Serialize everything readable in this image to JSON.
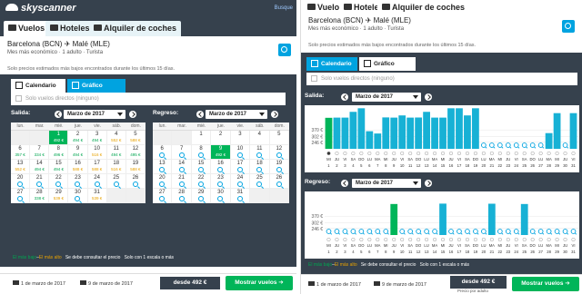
{
  "left": {
    "brand": "skyscanner",
    "top_link": "Busque",
    "tabs": [
      {
        "label": "Vuelos",
        "active": true
      },
      {
        "label": "Hoteles",
        "active": false
      },
      {
        "label": "Alquiler de coches",
        "active": false
      }
    ],
    "route": "Barcelona (BCN)  ✈  Malé (MLE)",
    "route_meta": "Mes más económico  ·  1 adulto  ·  Turista",
    "note": "Solo precios estimados más bajos encontrados durante los últimos 15 días.",
    "view_tabs": {
      "calendar": "Calendario",
      "chart": "Gráfico"
    },
    "direct_only": "Solo vuelos directos (ninguno)",
    "outbound_label": "Salida:",
    "return_label": "Regreso:",
    "month": "Marzo de 2017",
    "weekdays": [
      "lun.",
      "mar.",
      "mié.",
      "jue.",
      "vie.",
      "sáb.",
      "dom."
    ],
    "outbound_days": [
      {
        "d": ""
      },
      {
        "d": ""
      },
      {
        "d": "1",
        "p": "492 €",
        "sel": true
      },
      {
        "d": "2",
        "p": "494 €"
      },
      {
        "d": "3",
        "p": "494 €"
      },
      {
        "d": "4",
        "p": "552 €"
      },
      {
        "d": "5",
        "p": "588 €"
      },
      {
        "d": "6",
        "p": "357 €"
      },
      {
        "d": "7",
        "p": "334 €"
      },
      {
        "d": "8",
        "p": "496 €"
      },
      {
        "d": "9",
        "p": "494 €"
      },
      {
        "d": "10",
        "p": "516 €"
      },
      {
        "d": "11",
        "p": "494 €"
      },
      {
        "d": "12",
        "p": "495 €"
      },
      {
        "d": "13",
        "p": "552 €"
      },
      {
        "d": "14",
        "p": "494 €"
      },
      {
        "d": "15",
        "p": "494 €"
      },
      {
        "d": "16",
        "p": "588 €"
      },
      {
        "d": "17",
        "p": "588 €"
      },
      {
        "d": "18",
        "p": "516 €"
      },
      {
        "d": "19",
        "p": "588 €"
      },
      {
        "d": "20",
        "s": true
      },
      {
        "d": "21",
        "s": true
      },
      {
        "d": "22",
        "s": true
      },
      {
        "d": "23",
        "s": true
      },
      {
        "d": "24",
        "s": true
      },
      {
        "d": "25",
        "s": true
      },
      {
        "d": "26",
        "s": true
      },
      {
        "d": "27",
        "s": true
      },
      {
        "d": "28",
        "p": "338 €"
      },
      {
        "d": "29",
        "p": "539 €"
      },
      {
        "d": "30",
        "s": true
      },
      {
        "d": "31",
        "p": "539 €"
      },
      {
        "d": ""
      },
      {
        "d": ""
      }
    ],
    "return_days": [
      {
        "d": ""
      },
      {
        "d": ""
      },
      {
        "d": "1"
      },
      {
        "d": "2"
      },
      {
        "d": "3"
      },
      {
        "d": "4"
      },
      {
        "d": "5"
      },
      {
        "d": "6",
        "s": true
      },
      {
        "d": "7",
        "s": true
      },
      {
        "d": "8",
        "s": true
      },
      {
        "d": "9",
        "p": "492 €",
        "sel": true
      },
      {
        "d": "10",
        "s": true
      },
      {
        "d": "11",
        "s": true
      },
      {
        "d": "12",
        "s": true
      },
      {
        "d": "13",
        "s": true
      },
      {
        "d": "14",
        "s": true
      },
      {
        "d": "15",
        "s": true
      },
      {
        "d": "16",
        "s": true
      },
      {
        "d": "17",
        "s": true
      },
      {
        "d": "18",
        "s": true
      },
      {
        "d": "19",
        "s": true
      },
      {
        "d": "20",
        "s": true
      },
      {
        "d": "21",
        "s": true
      },
      {
        "d": "22",
        "s": true
      },
      {
        "d": "23",
        "s": true
      },
      {
        "d": "24",
        "s": true
      },
      {
        "d": "25",
        "s": true
      },
      {
        "d": "26",
        "s": true
      },
      {
        "d": "27",
        "s": true
      },
      {
        "d": "28",
        "s": true
      },
      {
        "d": "29",
        "s": true
      },
      {
        "d": "30",
        "s": true
      },
      {
        "d": "31",
        "s": true
      },
      {
        "d": ""
      },
      {
        "d": ""
      }
    ],
    "legend_low": "El más bajo",
    "legend_high": "El más alto",
    "legend_consult": "Se debe consultar el precio",
    "legend_stops": "Solo con 1 escala o más",
    "depart_date": "1 de marzo de 2017",
    "return_date": "9 de marzo de 2017",
    "from_price": "desde 492 €",
    "show_flights": "Mostrar vuelos"
  },
  "right": {
    "tabs": [
      {
        "label": "Vuelos",
        "active": true
      },
      {
        "label": "Hoteles",
        "active": false
      },
      {
        "label": "Alquiler de coches",
        "active": false
      }
    ],
    "route": "Barcelona (BCN)  ✈  Malé (MLE)",
    "route_meta": "Mes más económico  ·  1 adulto  ·  Turista",
    "note": "Solo precios estimados más bajos encontrados durante los últimos 15 días.",
    "view_tabs": {
      "calendar": "Calendario",
      "chart": "Gráfico"
    },
    "direct_only": "Solo vuelos directos (ninguno)",
    "outbound_label": "Salida:",
    "return_label": "Regreso:",
    "month": "Marzo de 2017",
    "legend_low": "El más bajo",
    "legend_high": "El más alto",
    "legend_consult": "Se debe consultar el precio",
    "legend_stops": "Solo con 1 escala o más",
    "depart_date": "1 de marzo de 2017",
    "return_date": "9 de marzo de 2017",
    "from_price": "desde 492 €",
    "price_note": "Precio por adulto",
    "show_flights": "Mostrar vuelos"
  },
  "colors": {
    "dark": "#36414d",
    "accent": "#00a3e0",
    "green": "#00b559",
    "bar": "#17b1d5"
  },
  "chart_data": [
    {
      "type": "bar",
      "title": "Salida:",
      "categories": [
        "MI",
        "JU",
        "VI",
        "SA",
        "DO",
        "LU",
        "MA",
        "MI",
        "JU",
        "VI",
        "SA",
        "DO",
        "LU",
        "MA",
        "MI",
        "JU",
        "VI",
        "SA",
        "DO",
        "LU",
        "MA",
        "MI",
        "JU",
        "VI",
        "SA",
        "DO",
        "LU",
        "MA",
        "MI",
        "JU",
        "VI"
      ],
      "days": [
        "1",
        "2",
        "3",
        "4",
        "5",
        "6",
        "7",
        "8",
        "9",
        "10",
        "11",
        "12",
        "13",
        "14",
        "15",
        "16",
        "17",
        "18",
        "19",
        "20",
        "21",
        "22",
        "23",
        "24",
        "25",
        "26",
        "27",
        "28",
        "29",
        "30",
        "31"
      ],
      "values": [
        492,
        494,
        494,
        552,
        588,
        357,
        334,
        496,
        494,
        516,
        494,
        495,
        552,
        494,
        494,
        588,
        588,
        516,
        588,
        null,
        null,
        null,
        null,
        null,
        null,
        null,
        null,
        338,
        539,
        null,
        539
      ],
      "yticks": [
        "370 €",
        "302 €",
        "246 €"
      ],
      "ylim": [
        180,
        600
      ]
    },
    {
      "type": "bar",
      "title": "Regreso:",
      "categories": [
        "MI",
        "JU",
        "VI",
        "SA",
        "DO",
        "LU",
        "MA",
        "MI",
        "JU",
        "VI",
        "SA",
        "DO",
        "LU",
        "MA",
        "MI",
        "JU",
        "VI",
        "SA",
        "DO",
        "LU",
        "MA",
        "MI",
        "JU",
        "VI",
        "SA",
        "DO",
        "LU",
        "MA",
        "MI",
        "JU",
        "VI"
      ],
      "days": [
        "1",
        "2",
        "3",
        "4",
        "5",
        "6",
        "7",
        "8",
        "9",
        "10",
        "11",
        "12",
        "13",
        "14",
        "15",
        "16",
        "17",
        "18",
        "19",
        "20",
        "21",
        "22",
        "23",
        "24",
        "25",
        "26",
        "27",
        "28",
        "29",
        "30",
        "31"
      ],
      "values": [
        null,
        null,
        null,
        null,
        null,
        null,
        null,
        null,
        492,
        null,
        null,
        null,
        null,
        null,
        496,
        null,
        null,
        null,
        null,
        null,
        495,
        null,
        null,
        null,
        492,
        null,
        null,
        null,
        null,
        null,
        null
      ],
      "yticks": [
        "370 €",
        "302 €",
        "246 €"
      ],
      "ylim": [
        180,
        600
      ]
    }
  ]
}
